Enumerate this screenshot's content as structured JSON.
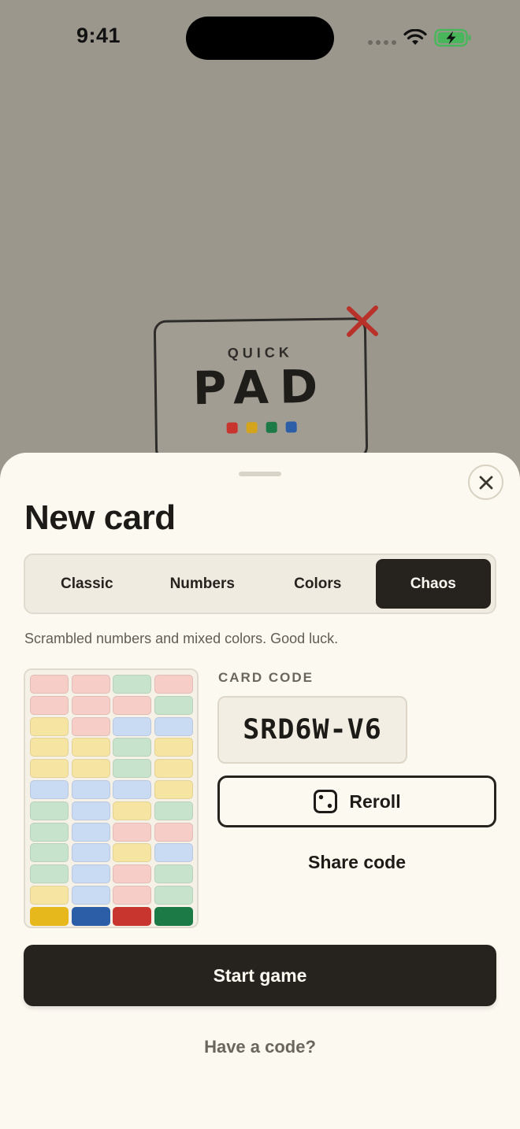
{
  "status_bar": {
    "time": "9:41"
  },
  "logo": {
    "quick": "QUICK",
    "pad": "PAD",
    "dot_colors": [
      "#c8342e",
      "#d4a51c",
      "#1c7a46",
      "#2c5ea8"
    ]
  },
  "sheet": {
    "title": "New card",
    "tabs": [
      {
        "label": "Classic",
        "active": false
      },
      {
        "label": "Numbers",
        "active": false
      },
      {
        "label": "Colors",
        "active": false
      },
      {
        "label": "Chaos",
        "active": true
      }
    ],
    "description": "Scrambled numbers and mixed colors. Good luck.",
    "preview_grid": [
      [
        "red",
        "red",
        "green",
        "red"
      ],
      [
        "red",
        "red",
        "red",
        "green"
      ],
      [
        "yellow",
        "red",
        "blue",
        "blue"
      ],
      [
        "yellow",
        "yellow",
        "green",
        "yellow"
      ],
      [
        "yellow",
        "yellow",
        "green",
        "yellow"
      ],
      [
        "blue",
        "blue",
        "blue",
        "yellow"
      ],
      [
        "green",
        "blue",
        "yellow",
        "green"
      ],
      [
        "green",
        "blue",
        "red",
        "red"
      ],
      [
        "green",
        "blue",
        "yellow",
        "blue"
      ],
      [
        "green",
        "blue",
        "red",
        "green"
      ],
      [
        "yellow",
        "blue",
        "red",
        "green"
      ],
      [
        "yellow-s",
        "blue-s",
        "red-s",
        "green-s"
      ]
    ],
    "code_label": "CARD CODE",
    "code_value": "SRD6W-V6",
    "reroll_label": "Reroll",
    "share_label": "Share code",
    "start_label": "Start game",
    "have_code_label": "Have a code?"
  },
  "colors": {
    "sheet_bg": "#fcf9f1",
    "dark": "#26231e",
    "backdrop": "#9b978d"
  }
}
